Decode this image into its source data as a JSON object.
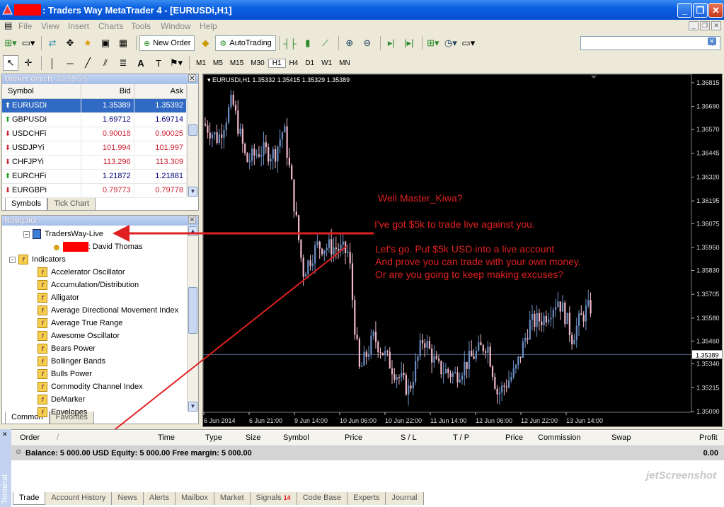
{
  "window": {
    "title": ": Traders Way MetaTrader 4 - [EURUSDi,H1]"
  },
  "menu": [
    "File",
    "View",
    "Insert",
    "Charts",
    "Tools",
    "Window",
    "Help"
  ],
  "toolbar": {
    "new_order": "New Order",
    "auto_trading": "AutoTrading"
  },
  "timeframes": [
    "M1",
    "M5",
    "M15",
    "M30",
    "H1",
    "H4",
    "D1",
    "W1",
    "MN"
  ],
  "timeframe_selected": "H1",
  "market_watch": {
    "title": "Market Watch: 22:59:59",
    "headers": {
      "symbol": "Symbol",
      "bid": "Bid",
      "ask": "Ask"
    },
    "rows": [
      {
        "symbol": "EURUSDi",
        "bid": "1.35389",
        "ask": "1.35392",
        "dir": "up"
      },
      {
        "symbol": "GBPUSDi",
        "bid": "1.69712",
        "ask": "1.69714",
        "dir": "up"
      },
      {
        "symbol": "USDCHFi",
        "bid": "0.90018",
        "ask": "0.90025",
        "dir": "down"
      },
      {
        "symbol": "USDJPYi",
        "bid": "101.994",
        "ask": "101.997",
        "dir": "down"
      },
      {
        "symbol": "CHFJPYi",
        "bid": "113.296",
        "ask": "113.309",
        "dir": "down"
      },
      {
        "symbol": "EURCHFi",
        "bid": "1.21872",
        "ask": "1.21881",
        "dir": "up"
      },
      {
        "symbol": "EURGBPi",
        "bid": "0.79773",
        "ask": "0.79778",
        "dir": "down"
      }
    ],
    "tabs": [
      "Symbols",
      "Tick Chart"
    ]
  },
  "navigator": {
    "title": "Navigator",
    "account_server": "TradersWay-Live",
    "account_name": ": David Thomas",
    "indicators_label": "Indicators",
    "indicators": [
      "Accelerator Oscillator",
      "Accumulation/Distribution",
      "Alligator",
      "Average Directional Movement Index",
      "Average True Range",
      "Awesome Oscillator",
      "Bears Power",
      "Bollinger Bands",
      "Bulls Power",
      "Commodity Channel Index",
      "DeMarker",
      "Envelopes"
    ],
    "tabs": [
      "Common",
      "Favorites"
    ]
  },
  "chart": {
    "header": "EURUSDi,H1  1.35332 1.35415 1.35329 1.35389",
    "price_labels": [
      "1.36815",
      "1.36690",
      "1.36570",
      "1.36445",
      "1.36320",
      "1.36195",
      "1.36075",
      "1.35950",
      "1.35830",
      "1.35705",
      "1.35580",
      "1.35460",
      "1.35340",
      "1.35215",
      "1.35090"
    ],
    "current_price": "1.35389",
    "time_labels": [
      "6 Jun 2014",
      "6 Jun 21:00",
      "9 Jun 14:00",
      "10 Jun 06:00",
      "10 Jun 22:00",
      "11 Jun 14:00",
      "12 Jun 06:00",
      "12 Jun 22:00",
      "13 Jun 14:00"
    ],
    "annotation": [
      "Well Master_Kiwa?",
      "I've got $5k to trade live against you.",
      "Let's go. Put $5k USD into a live account",
      "And prove you can trade with your own money.",
      "Or are you going to keep making excuses?"
    ]
  },
  "terminal": {
    "side_label": "Terminal",
    "headers": [
      "Order",
      "/",
      "Time",
      "Type",
      "Size",
      "Symbol",
      "Price",
      "S / L",
      "T / P",
      "Price",
      "Commission",
      "Swap",
      "Profit"
    ],
    "balance_line": "Balance: 5 000.00 USD  Equity: 5 000.00  Free margin: 5 000.00",
    "profit": "0.00",
    "tabs": [
      "Trade",
      "Account History",
      "News",
      "Alerts",
      "Mailbox",
      "Market",
      "Signals",
      "Code Base",
      "Experts",
      "Journal"
    ],
    "signals_badge": "14"
  },
  "watermark": "jetScreenshot"
}
